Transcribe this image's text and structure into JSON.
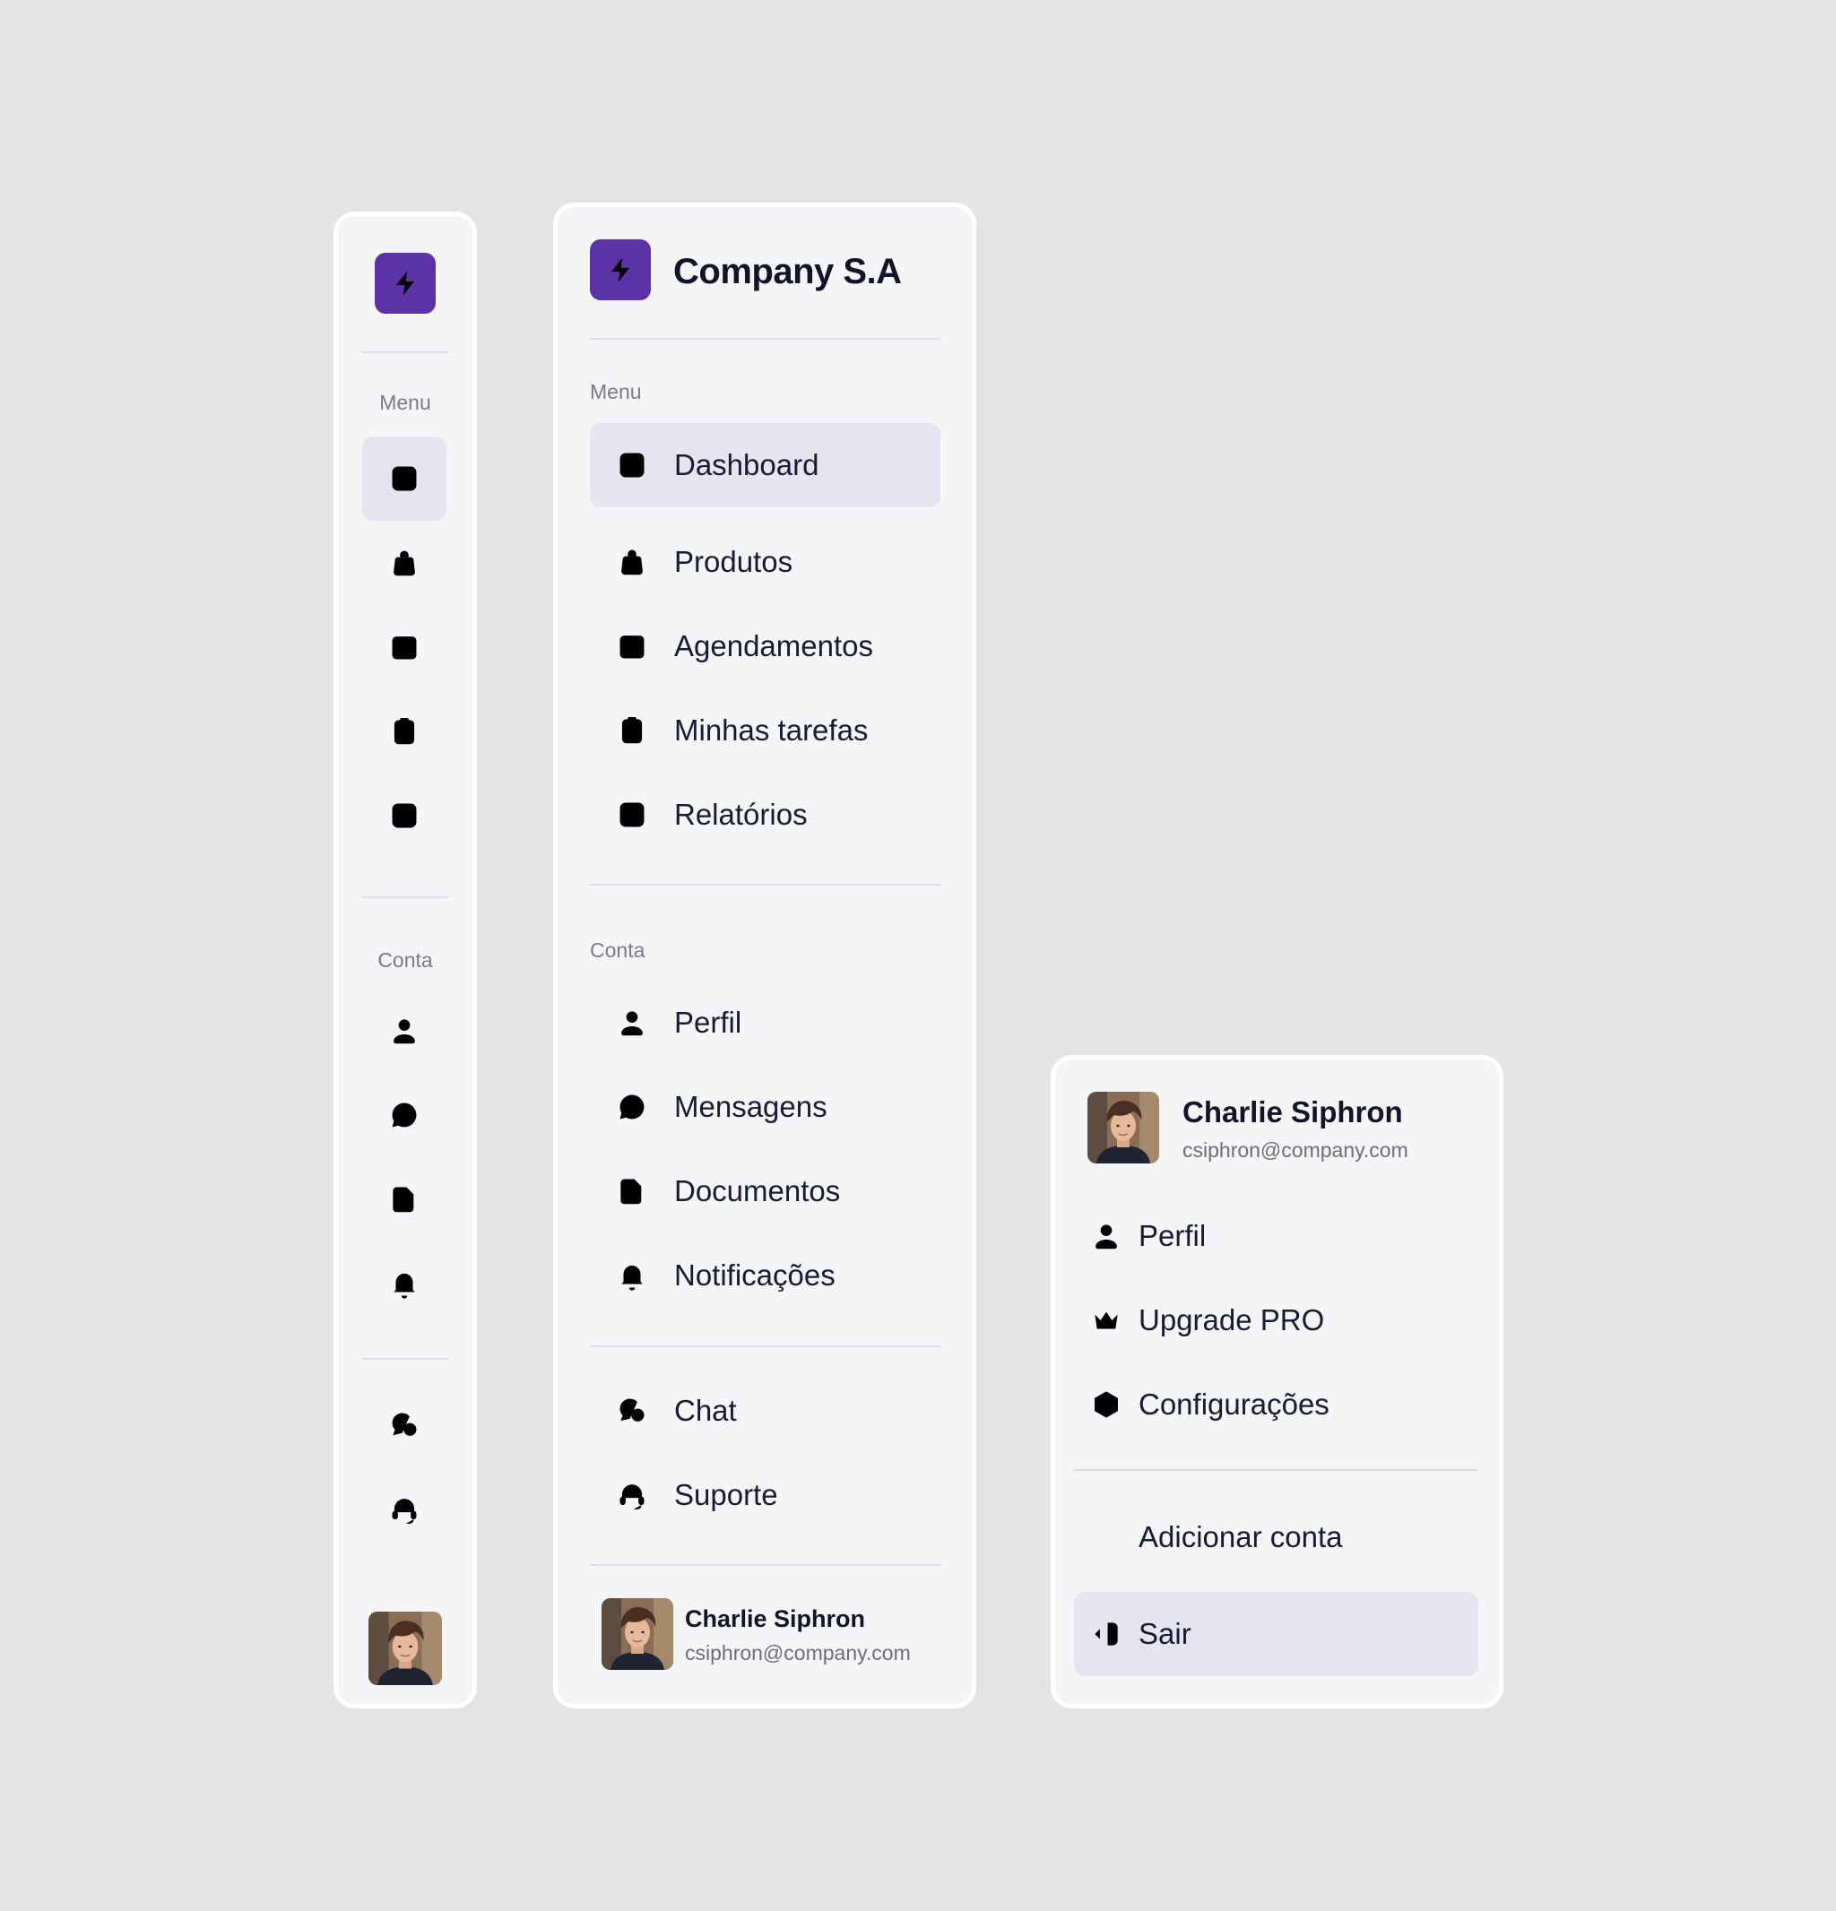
{
  "brand": {
    "name": "Company S.A",
    "logo_icon": "lightning-bolt-icon",
    "accent_color": "#5b33a6"
  },
  "sections": {
    "menu": "Menu",
    "account": "Conta"
  },
  "menu_items": [
    {
      "label": "Dashboard",
      "icon": "chart-icon",
      "active": true
    },
    {
      "label": "Produtos",
      "icon": "bag-icon"
    },
    {
      "label": "Agendamentos",
      "icon": "calendar-icon"
    },
    {
      "label": "Minhas tarefas",
      "icon": "clipboard-icon"
    },
    {
      "label": "Relatórios",
      "icon": "report-chart-icon"
    }
  ],
  "account_items": [
    {
      "label": "Perfil",
      "icon": "user-icon"
    },
    {
      "label": "Mensagens",
      "icon": "message-icon"
    },
    {
      "label": "Documentos",
      "icon": "document-icon"
    },
    {
      "label": "Notificações",
      "icon": "bell-icon"
    }
  ],
  "support_items": [
    {
      "label": "Chat",
      "icon": "chat-icon"
    },
    {
      "label": "Suporte",
      "icon": "headset-icon"
    }
  ],
  "user": {
    "name": "Charlie Siphron",
    "email": "csiphron@company.com"
  },
  "account_menu": {
    "items": [
      {
        "label": "Perfil",
        "icon": "user-icon"
      },
      {
        "label": "Upgrade PRO",
        "icon": "crown-icon"
      },
      {
        "label": "Configurações",
        "icon": "settings-icon"
      }
    ],
    "add_account": {
      "label": "Adicionar conta",
      "icon": "plus-icon"
    },
    "logout": {
      "label": "Sair",
      "icon": "logout-icon",
      "active": true
    }
  }
}
